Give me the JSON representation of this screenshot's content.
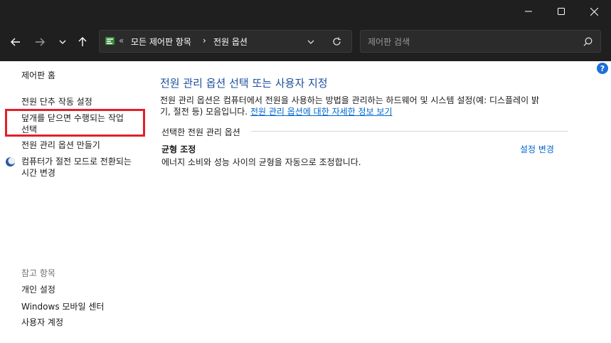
{
  "window": {
    "minimize_icon": "minimize-icon",
    "maximize_icon": "maximize-icon",
    "close_icon": "close-icon"
  },
  "nav": {
    "back_icon": "back-arrow-icon",
    "forward_icon": "forward-arrow-icon",
    "recent_icon": "chevron-down-icon",
    "up_icon": "up-arrow-icon",
    "breadcrumb_overflow": "«",
    "breadcrumb": [
      "모든 제어판 항목",
      "전원 옵션"
    ],
    "breadcrumb_sep": "›",
    "dropdown_icon": "chevron-down-icon",
    "refresh_icon": "refresh-icon"
  },
  "search": {
    "placeholder": "제어판 검색",
    "icon": "search-icon"
  },
  "sidebar": {
    "home": "제어판 홈",
    "links": [
      "전원 단추 작동 설정",
      "덮개를 닫으면 수행되는 작업 선택",
      "전원 관리 옵션 만들기",
      "컴퓨터가 절전 모드로 전환되는 시간 변경"
    ],
    "see_also_title": "참고 항목",
    "see_also": [
      "개인 설정",
      "Windows 모바일 센터",
      "사용자 계정"
    ]
  },
  "main": {
    "title": "전원 관리 옵션 선택 또는 사용자 지정",
    "description_line1": "전원 관리 옵션은 컴퓨터에서 전원을 사용하는 방법을 관리하는 하드웨어 및 시스템 설정(예: 디스플레이 밝",
    "description_line2": "기, 절전 등) 모음입니다.",
    "description_link": "전원 관리 옵션에 대한 자세한 정보 보기",
    "section_title": "선택한 전원 관리 옵션",
    "plan_name": "균형 조정",
    "plan_desc": "에너지 소비와 성능 사이의 균형을 자동으로 조정합니다.",
    "plan_settings_link": "설정 변경"
  },
  "help": "?",
  "highlight_color": "#e3202a"
}
